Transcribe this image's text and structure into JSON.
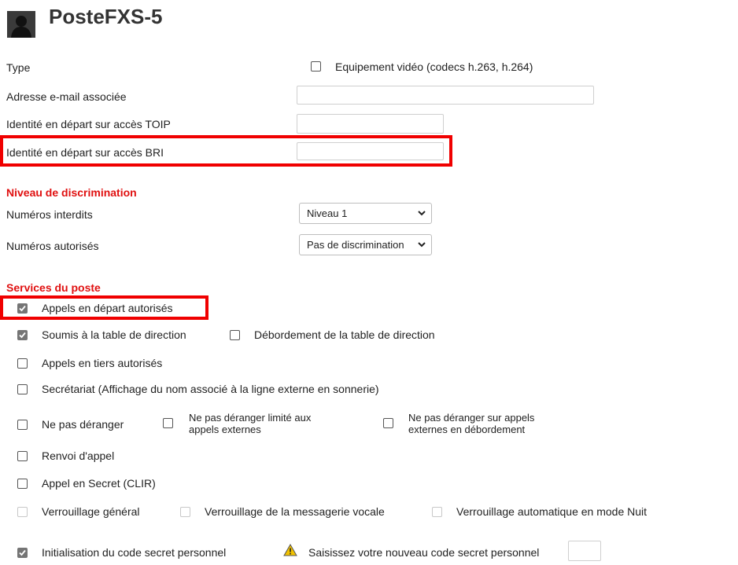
{
  "header": {
    "title": "PosteFXS-5"
  },
  "general": {
    "type_label": "Type",
    "video_checkbox_label": "Equipement vidéo (codecs h.263, h.264)",
    "email_label": "Adresse e-mail associée",
    "email_value": "",
    "toip_label": "Identité en départ sur accès TOIP",
    "toip_value": "",
    "bri_label": "Identité en départ sur accès BRI",
    "bri_value": ""
  },
  "discrimination": {
    "section_title": "Niveau de discrimination",
    "forbidden_label": "Numéros interdits",
    "forbidden_value": "Niveau 1",
    "allowed_label": "Numéros autorisés",
    "allowed_value": "Pas de discrimination"
  },
  "services": {
    "section_title": "Services du poste",
    "appels_depart": "Appels en départ autorisés",
    "soumis_table": "Soumis à la table de direction",
    "debordement_table": "Débordement de la table de direction",
    "appels_tiers": "Appels en tiers autorisés",
    "secretariat": "Secrétariat (Affichage du nom associé à la ligne externe en sonnerie)",
    "npd": "Ne pas déranger",
    "npd_limite_1": "Ne pas déranger limité aux",
    "npd_limite_2": "appels externes",
    "npd_debord_1": "Ne pas déranger sur appels",
    "npd_debord_2": "externes en débordement",
    "renvoi": "Renvoi d'appel",
    "clir": "Appel en Secret (CLIR)",
    "verrou_general": "Verrouillage général",
    "verrou_messagerie": "Verrouillage de la messagerie vocale",
    "verrou_nuit": "Verrouillage automatique en mode Nuit",
    "init_code": "Initialisation du code secret personnel",
    "new_code_prompt": "Saisissez votre nouveau code secret personnel",
    "new_code_value": ""
  },
  "colors": {
    "highlight": "#f00000",
    "section": "#e01010",
    "checked": "#757575"
  }
}
